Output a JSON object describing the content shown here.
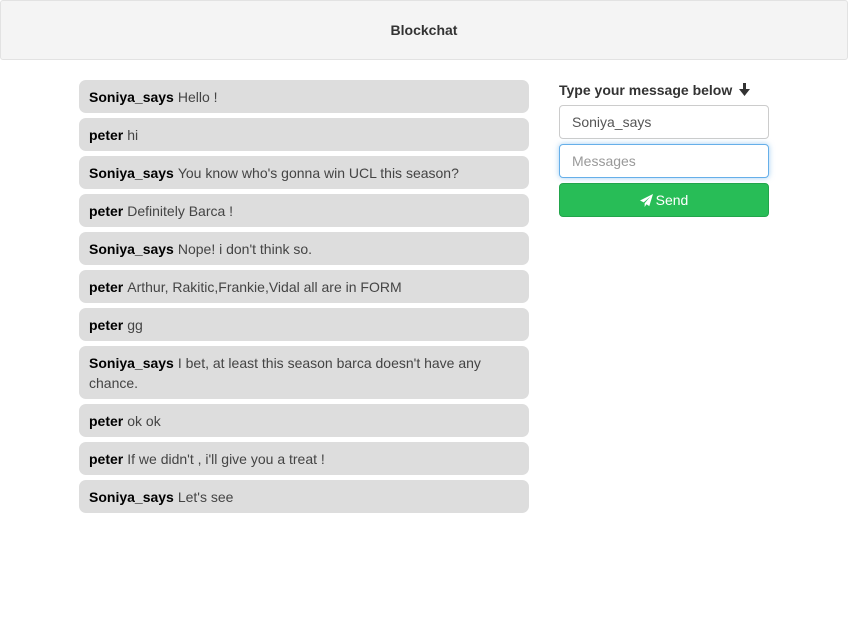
{
  "header": {
    "title": "Blockchat"
  },
  "messages": [
    {
      "sender": "Soniya_says",
      "text": "Hello !"
    },
    {
      "sender": "peter",
      "text": "hi"
    },
    {
      "sender": "Soniya_says",
      "text": "You know who's gonna win UCL this season?"
    },
    {
      "sender": "peter",
      "text": "Definitely Barca !"
    },
    {
      "sender": "Soniya_says",
      "text": "Nope! i don't think so."
    },
    {
      "sender": "peter",
      "text": "Arthur, Rakitic,Frankie,Vidal all are in FORM"
    },
    {
      "sender": "peter",
      "text": "gg"
    },
    {
      "sender": "Soniya_says",
      "text": "I bet, at least this season barca doesn't have any chance."
    },
    {
      "sender": "peter",
      "text": "ok ok"
    },
    {
      "sender": "peter",
      "text": "If we didn't , i'll give you a treat !"
    },
    {
      "sender": "Soniya_says",
      "text": "Let's see"
    }
  ],
  "compose": {
    "prompt": "Type your message below",
    "prompt_icon": "arrow-down-icon",
    "name_value": "Soniya_says",
    "message_placeholder": "Messages",
    "message_value": "",
    "send_label": "Send",
    "send_icon": "paper-plane-icon"
  },
  "colors": {
    "send_button": "#28bd57",
    "bubble": "#dddddd",
    "navbar": "#f4f4f4"
  }
}
